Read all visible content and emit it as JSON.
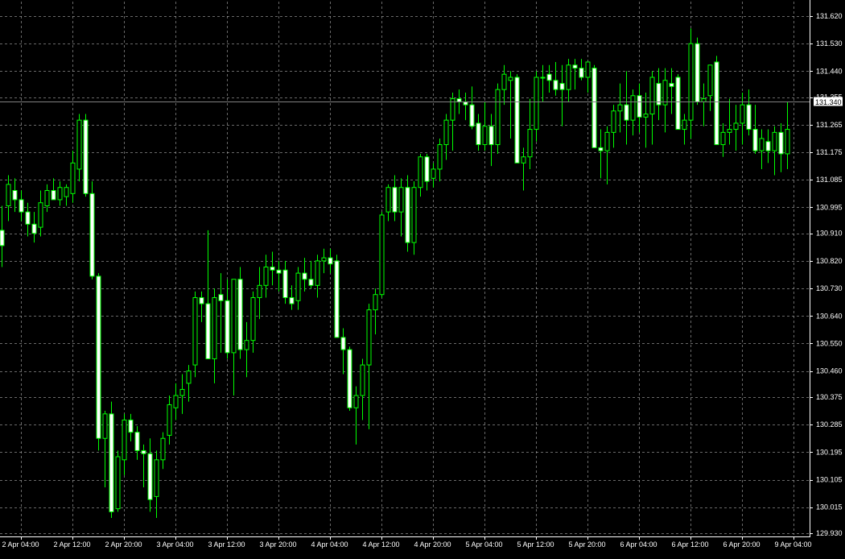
{
  "chart_data": {
    "type": "candlestick",
    "grid": true,
    "colors": {
      "background": "#000000",
      "candle": "#00ff00",
      "bull_body": "#000000",
      "bear_body": "#ffffff",
      "grid": "#c0c0c0",
      "axis": "#ffffff",
      "price_line": "#808080"
    },
    "ylim": [
      129.93,
      131.665
    ],
    "y_ticks": [
      "131.620",
      "131.530",
      "131.440",
      "131.355",
      "131.265",
      "131.175",
      "131.085",
      "130.995",
      "130.910",
      "130.820",
      "130.730",
      "130.640",
      "130.550",
      "130.460",
      "130.375",
      "130.285",
      "130.195",
      "130.105",
      "130.015",
      "129.930"
    ],
    "x_ticks": [
      {
        "label": "2 Apr 04:00",
        "index": 3
      },
      {
        "label": "2 Apr 12:00",
        "index": 11
      },
      {
        "label": "2 Apr 20:00",
        "index": 19
      },
      {
        "label": "3 Apr 04:00",
        "index": 27
      },
      {
        "label": "3 Apr 12:00",
        "index": 35
      },
      {
        "label": "3 Apr 20:00",
        "index": 43
      },
      {
        "label": "4 Apr 04:00",
        "index": 51
      },
      {
        "label": "4 Apr 12:00",
        "index": 59
      },
      {
        "label": "4 Apr 20:00",
        "index": 67
      },
      {
        "label": "5 Apr 04:00",
        "index": 75
      },
      {
        "label": "5 Apr 12:00",
        "index": 83
      },
      {
        "label": "5 Apr 20:00",
        "index": 91
      },
      {
        "label": "6 Apr 04:00",
        "index": 99
      },
      {
        "label": "6 Apr 12:00",
        "index": 107
      },
      {
        "label": "6 Apr 20:00",
        "index": 115
      },
      {
        "label": "9 Apr 04:00",
        "index": 123
      }
    ],
    "current_price": "131.340",
    "candles": [
      [
        130.92,
        131.0,
        130.8,
        130.87
      ],
      [
        131.0,
        131.1,
        130.95,
        131.07
      ],
      [
        131.05,
        131.09,
        130.98,
        131.02
      ],
      [
        131.02,
        131.05,
        130.95,
        130.98
      ],
      [
        130.98,
        131.01,
        130.9,
        130.94
      ],
      [
        130.94,
        130.98,
        130.88,
        130.91
      ],
      [
        130.93,
        131.05,
        130.9,
        131.01
      ],
      [
        131.0,
        131.07,
        130.98,
        131.05
      ],
      [
        131.05,
        131.09,
        131.02,
        131.02
      ],
      [
        131.02,
        131.08,
        131.0,
        131.06
      ],
      [
        131.03,
        131.07,
        131.0,
        131.06
      ],
      [
        131.04,
        131.18,
        131.01,
        131.14
      ],
      [
        131.12,
        131.3,
        131.08,
        131.28
      ],
      [
        131.28,
        131.3,
        131.03,
        131.04
      ],
      [
        131.04,
        131.08,
        130.76,
        130.77
      ],
      [
        130.77,
        130.78,
        130.2,
        130.24
      ],
      [
        130.24,
        130.33,
        130.08,
        130.32
      ],
      [
        130.32,
        130.36,
        129.98,
        130.0
      ],
      [
        130.01,
        130.2,
        130.0,
        130.18
      ],
      [
        130.17,
        130.32,
        130.12,
        130.3
      ],
      [
        130.3,
        130.32,
        130.23,
        130.26
      ],
      [
        130.26,
        130.28,
        130.17,
        130.2
      ],
      [
        130.2,
        130.22,
        130.08,
        130.19
      ],
      [
        130.19,
        130.24,
        130.0,
        130.04
      ],
      [
        130.05,
        130.2,
        129.98,
        130.17
      ],
      [
        130.17,
        130.26,
        130.14,
        130.24
      ],
      [
        130.25,
        130.38,
        130.22,
        130.35
      ],
      [
        130.34,
        130.42,
        130.3,
        130.38
      ],
      [
        130.38,
        130.45,
        130.32,
        130.4
      ],
      [
        130.42,
        130.48,
        130.36,
        130.46
      ],
      [
        130.48,
        130.72,
        130.44,
        130.7
      ],
      [
        130.7,
        130.72,
        130.62,
        130.68
      ],
      [
        130.68,
        130.92,
        130.5,
        130.5
      ],
      [
        130.5,
        130.73,
        130.42,
        130.7
      ],
      [
        130.71,
        130.78,
        130.52,
        130.69
      ],
      [
        130.69,
        130.76,
        130.5,
        130.52
      ],
      [
        130.52,
        130.76,
        130.38,
        130.76
      ],
      [
        130.76,
        130.8,
        130.5,
        130.53
      ],
      [
        130.53,
        130.62,
        130.44,
        130.56
      ],
      [
        130.56,
        130.72,
        130.52,
        130.7
      ],
      [
        130.7,
        130.8,
        130.63,
        130.74
      ],
      [
        130.74,
        130.84,
        130.7,
        130.8
      ],
      [
        130.8,
        130.85,
        130.74,
        130.79
      ],
      [
        130.79,
        130.82,
        130.72,
        130.78
      ],
      [
        130.79,
        130.82,
        130.68,
        130.7
      ],
      [
        130.7,
        130.74,
        130.66,
        130.68
      ],
      [
        130.69,
        130.8,
        130.66,
        130.78
      ],
      [
        130.78,
        130.83,
        130.72,
        130.76
      ],
      [
        130.76,
        130.82,
        130.73,
        130.74
      ],
      [
        130.74,
        130.84,
        130.7,
        130.82
      ],
      [
        130.82,
        130.86,
        130.78,
        130.83
      ],
      [
        130.83,
        130.86,
        130.78,
        130.81
      ],
      [
        130.82,
        130.84,
        130.57,
        130.57
      ],
      [
        130.57,
        130.6,
        130.45,
        130.53
      ],
      [
        130.53,
        130.54,
        130.33,
        130.34
      ],
      [
        130.34,
        130.41,
        130.22,
        130.38
      ],
      [
        130.38,
        130.5,
        130.3,
        130.48
      ],
      [
        130.48,
        130.68,
        130.27,
        130.66
      ],
      [
        130.66,
        130.73,
        130.58,
        130.71
      ],
      [
        130.71,
        130.98,
        130.7,
        130.97
      ],
      [
        130.98,
        131.07,
        130.95,
        131.06
      ],
      [
        131.06,
        131.1,
        130.95,
        130.98
      ],
      [
        130.98,
        131.09,
        130.9,
        131.06
      ],
      [
        131.06,
        131.1,
        130.85,
        130.88
      ],
      [
        130.88,
        131.08,
        130.84,
        131.06
      ],
      [
        131.06,
        131.17,
        131.03,
        131.16
      ],
      [
        131.16,
        131.17,
        131.05,
        131.08
      ],
      [
        131.09,
        131.14,
        131.06,
        131.12
      ],
      [
        131.12,
        131.22,
        131.08,
        131.2
      ],
      [
        131.2,
        131.3,
        131.15,
        131.28
      ],
      [
        131.28,
        131.37,
        131.18,
        131.35
      ],
      [
        131.35,
        131.38,
        131.3,
        131.34
      ],
      [
        131.34,
        131.37,
        131.28,
        131.33
      ],
      [
        131.33,
        131.39,
        131.25,
        131.26
      ],
      [
        131.27,
        131.3,
        131.18,
        131.2
      ],
      [
        131.2,
        131.34,
        131.18,
        131.26
      ],
      [
        131.26,
        131.3,
        131.13,
        131.2
      ],
      [
        131.2,
        131.4,
        131.17,
        131.38
      ],
      [
        131.38,
        131.46,
        131.33,
        131.43
      ],
      [
        131.41,
        131.44,
        131.22,
        131.42
      ],
      [
        131.42,
        131.43,
        131.14,
        131.14
      ],
      [
        131.14,
        131.19,
        131.05,
        131.16
      ],
      [
        131.16,
        131.35,
        131.12,
        131.25
      ],
      [
        131.25,
        131.44,
        131.21,
        131.42
      ],
      [
        131.42,
        131.46,
        131.34,
        131.42
      ],
      [
        131.43,
        131.46,
        131.37,
        131.41
      ],
      [
        131.41,
        131.47,
        131.36,
        131.38
      ],
      [
        131.4,
        131.46,
        131.26,
        131.38
      ],
      [
        131.38,
        131.48,
        131.34,
        131.46
      ],
      [
        131.46,
        131.48,
        131.38,
        131.45
      ],
      [
        131.45,
        131.48,
        131.41,
        131.42
      ],
      [
        131.42,
        131.47,
        131.37,
        131.47
      ],
      [
        131.45,
        131.46,
        131.19,
        131.19
      ],
      [
        131.19,
        131.25,
        131.09,
        131.18
      ],
      [
        131.18,
        131.26,
        131.07,
        131.24
      ],
      [
        131.24,
        131.33,
        131.19,
        131.31
      ],
      [
        131.31,
        131.4,
        131.24,
        131.33
      ],
      [
        131.33,
        131.44,
        131.2,
        131.28
      ],
      [
        131.28,
        131.38,
        131.23,
        131.36
      ],
      [
        131.36,
        131.4,
        131.24,
        131.29
      ],
      [
        131.29,
        131.37,
        131.19,
        131.3
      ],
      [
        131.3,
        131.44,
        131.2,
        131.42
      ],
      [
        131.4,
        131.45,
        131.28,
        131.33
      ],
      [
        131.33,
        131.45,
        131.24,
        131.41
      ],
      [
        131.4,
        131.45,
        131.3,
        131.39
      ],
      [
        131.42,
        131.43,
        131.25,
        131.25
      ],
      [
        131.25,
        131.3,
        131.2,
        131.28
      ],
      [
        131.28,
        131.58,
        131.22,
        131.53
      ],
      [
        131.53,
        131.55,
        131.33,
        131.34
      ],
      [
        131.34,
        131.4,
        131.26,
        131.35
      ],
      [
        131.36,
        131.46,
        131.31,
        131.46
      ],
      [
        131.47,
        131.49,
        131.2,
        131.2
      ],
      [
        131.2,
        131.27,
        131.16,
        131.24
      ],
      [
        131.24,
        131.35,
        131.2,
        131.25
      ],
      [
        131.25,
        131.33,
        131.18,
        131.27
      ],
      [
        131.27,
        131.37,
        131.2,
        131.33
      ],
      [
        131.33,
        131.38,
        131.23,
        131.25
      ],
      [
        131.25,
        131.33,
        131.17,
        131.18
      ],
      [
        131.18,
        131.25,
        131.12,
        131.22
      ],
      [
        131.21,
        131.25,
        131.14,
        131.18
      ],
      [
        131.18,
        131.26,
        131.1,
        131.24
      ],
      [
        131.24,
        131.27,
        131.11,
        131.17
      ],
      [
        131.17,
        131.34,
        131.12,
        131.25
      ]
    ]
  }
}
